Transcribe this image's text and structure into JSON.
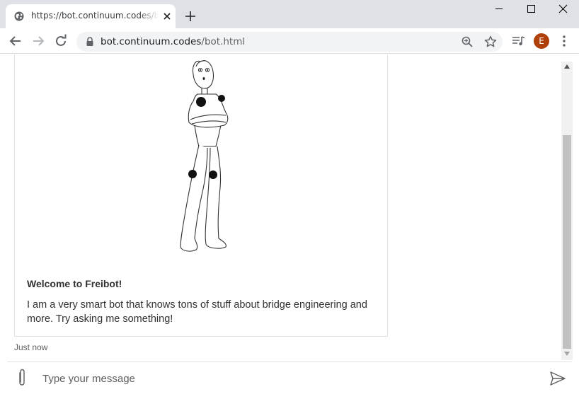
{
  "browser": {
    "tab": {
      "title": "https://bot.continuum.codes/bot.html"
    },
    "address": {
      "domain": "bot.continuum.codes",
      "path": "/bot.html"
    },
    "profile_initial": "E"
  },
  "chat": {
    "card": {
      "title": "Welcome to Freibot!",
      "text": "I am a very smart bot that knows tons of stuff about bridge engineering and more. Try asking me something!"
    },
    "timestamp": "Just now",
    "input": {
      "placeholder": "Type your message",
      "value": ""
    }
  }
}
